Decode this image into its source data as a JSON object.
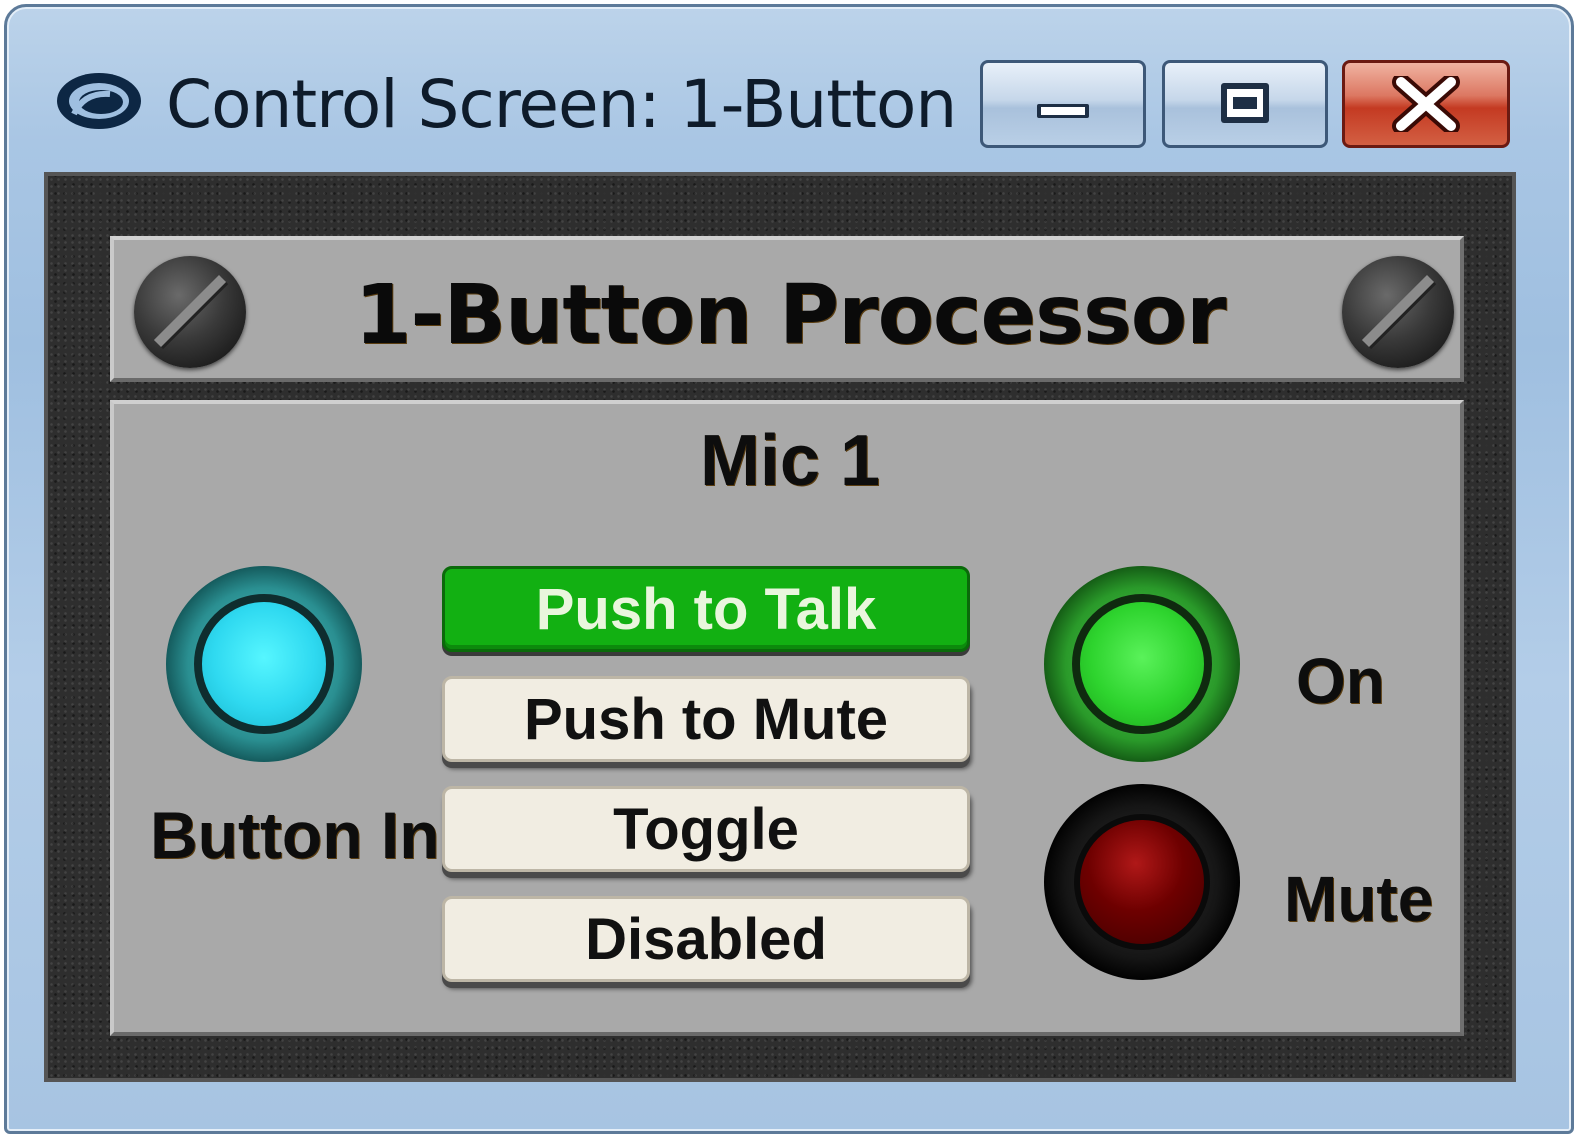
{
  "window": {
    "title": "Control Screen: 1-Button ...",
    "app_icon": "qsc-logo-icon",
    "controls": {
      "minimize_icon": "minimize-icon",
      "maximize_icon": "maximize-icon",
      "close_icon": "close-icon"
    }
  },
  "panel": {
    "title": "1-Button Processor",
    "channel_title": "Mic 1",
    "input_indicator": {
      "label": "Button Input",
      "color": "#2fd9f0",
      "state": "lit"
    },
    "modes": [
      {
        "label": "Push to Talk",
        "active": true
      },
      {
        "label": "Push to Mute",
        "active": false
      },
      {
        "label": "Toggle",
        "active": false
      },
      {
        "label": "Disabled",
        "active": false
      }
    ],
    "on_indicator": {
      "label": "On",
      "color": "#2ed42e",
      "state": "lit"
    },
    "mute_indicator": {
      "label": "Mute",
      "color": "#6e0000",
      "state": "unlit"
    }
  },
  "colors": {
    "active_button": "#12b012",
    "inactive_button": "#f1ede2",
    "plate": "#a9a9a9"
  }
}
